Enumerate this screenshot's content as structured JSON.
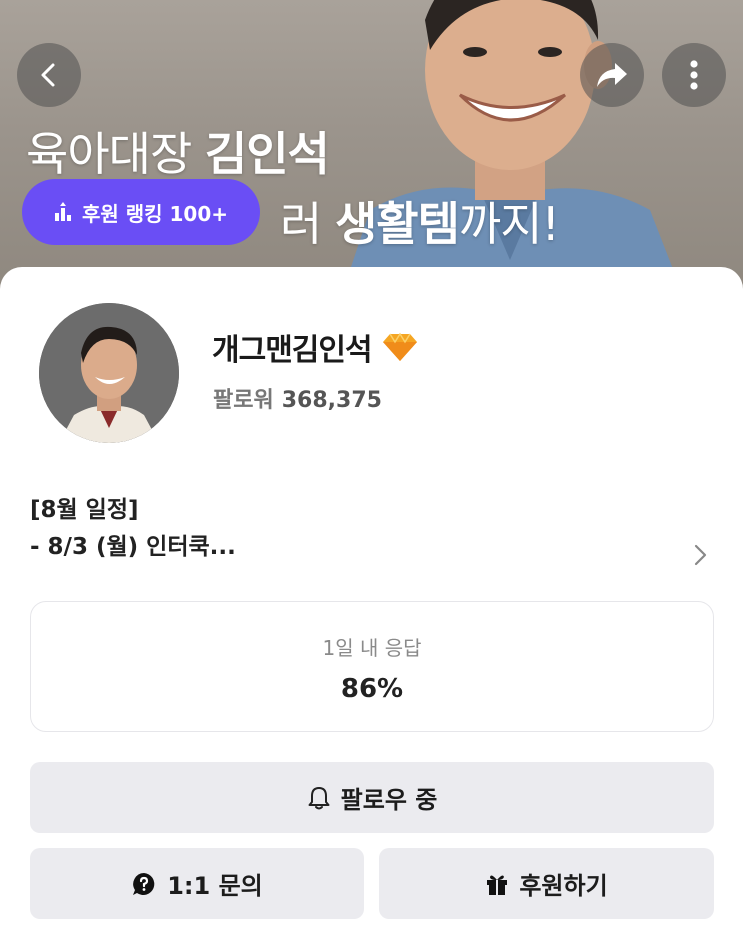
{
  "hero": {
    "line1_regular": "육아대장 ",
    "line1_bold": "김인석",
    "line2_regular": "러 ",
    "line2_bold": "생활템",
    "line2_tail": "까지!",
    "rank_badge": "후원 랭킹 100+"
  },
  "profile": {
    "name": "개그맨김인석",
    "followers_label": "팔로워",
    "followers_count": "368,375"
  },
  "bio": {
    "line1": "[8월 일정]",
    "line2": "- 8/3 (월) 인터쿡..."
  },
  "response": {
    "label": "1일 내 응답",
    "value": "86%"
  },
  "buttons": {
    "follow": "팔로우 중",
    "inquiry": "1:1 문의",
    "donate": "후원하기"
  },
  "colors": {
    "accent": "#6a4ef5",
    "badge_gem": "#f5a623",
    "button_bg": "#ebebef"
  },
  "icons": {
    "back": "chevron-left-icon",
    "share": "share-arrow-icon",
    "more": "more-vertical-icon",
    "rank": "ranking-bars-icon",
    "verified": "diamond-icon",
    "bio_expand": "chevron-right-icon",
    "follow": "bell-icon",
    "inquiry": "question-bubble-icon",
    "donate": "gift-icon"
  }
}
